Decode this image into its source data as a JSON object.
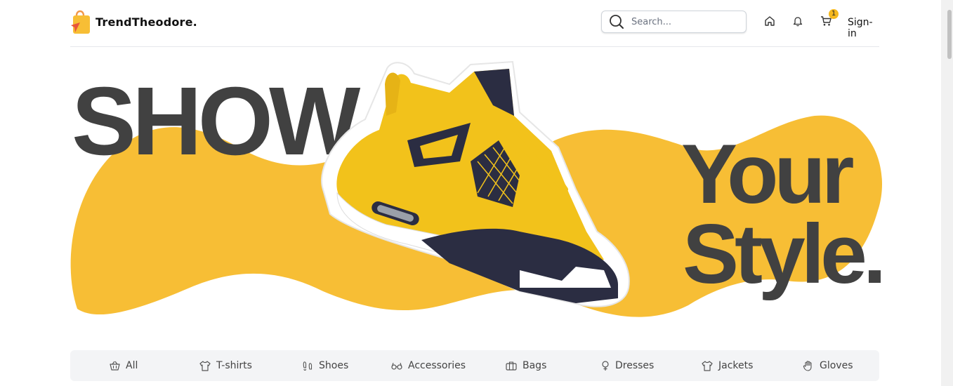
{
  "header": {
    "brand": "TrendTheodore.",
    "search_placeholder": "Search...",
    "cart_count": "1",
    "signin_label": "Sign-in",
    "icons": [
      "logo-bag-icon",
      "search-icon",
      "home-icon",
      "bell-icon",
      "cart-icon"
    ]
  },
  "hero": {
    "word1": "SHOW",
    "word2": "Your",
    "word3": "Style.",
    "accent_color": "#f7be35",
    "text_color": "#414141"
  },
  "categories": [
    {
      "label": "All",
      "icon": "basket-icon"
    },
    {
      "label": "T-shirts",
      "icon": "tshirt-icon"
    },
    {
      "label": "Shoes",
      "icon": "footprints-icon"
    },
    {
      "label": "Accessories",
      "icon": "glasses-icon"
    },
    {
      "label": "Bags",
      "icon": "briefcase-icon"
    },
    {
      "label": "Dresses",
      "icon": "venus-icon"
    },
    {
      "label": "Jackets",
      "icon": "shirt-icon"
    },
    {
      "label": "Gloves",
      "icon": "hand-icon"
    }
  ]
}
